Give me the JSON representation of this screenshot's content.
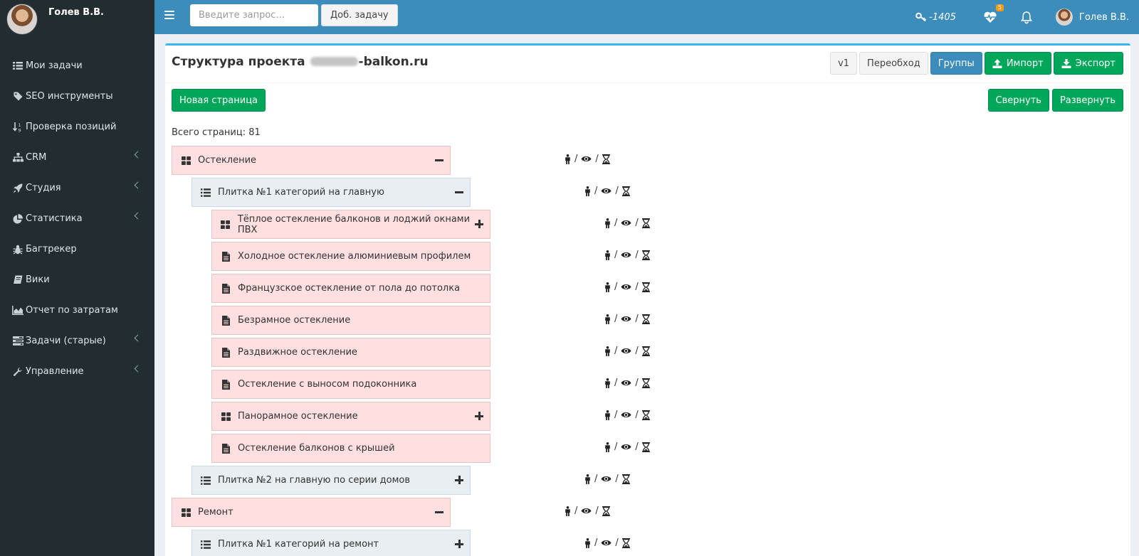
{
  "sidebar": {
    "user_name": "Голев В.В.",
    "items": [
      {
        "label": "Мои задачи",
        "icon": "list-icon",
        "has_children": false
      },
      {
        "label": "SEO инструменты",
        "icon": "tag-icon",
        "has_children": false
      },
      {
        "label": "Проверка позиций",
        "icon": "sort-numeric-icon",
        "has_children": false
      },
      {
        "label": "CRM",
        "icon": "sitemap-icon",
        "has_children": true
      },
      {
        "label": "Студия",
        "icon": "rocket-icon",
        "has_children": true
      },
      {
        "label": "Статистика",
        "icon": "pie-chart-icon",
        "has_children": true
      },
      {
        "label": "Багтрекер",
        "icon": "bug-icon",
        "has_children": false
      },
      {
        "label": "Вики",
        "icon": "book-icon",
        "has_children": false
      },
      {
        "label": "Отчет по затратам",
        "icon": "area-chart-icon",
        "has_children": false
      },
      {
        "label": "Задачи (старые)",
        "icon": "tasks-icon",
        "has_children": true
      },
      {
        "label": "Управление",
        "icon": "wrench-icon",
        "has_children": true
      }
    ]
  },
  "header": {
    "search_placeholder": "Введите запрос...",
    "add_task_label": "Доб. задачу",
    "key_count": "-1405",
    "health_badge": "5",
    "user_name": "Голев В.В."
  },
  "content": {
    "title_prefix": "Структура проекта",
    "title_suffix": "-balkon.ru",
    "tools": {
      "v1": "v1",
      "recrawl": "Переобход",
      "groups": "Группы",
      "import": "Импорт",
      "export": "Экспорт"
    },
    "new_page_label": "Новая страница",
    "collapse_label": "Свернуть",
    "expand_label": "Развернуть",
    "total_label": "Всего страниц: 81"
  },
  "tree": [
    {
      "label": "Остекление",
      "level": 0,
      "type": "group",
      "toggle": "minus"
    },
    {
      "label": "Плитка №1 категорий на главную",
      "level": 1,
      "type": "list",
      "toggle": "minus"
    },
    {
      "label": "Тёплое остекление балконов и лоджий окнами ПВХ",
      "level": 2,
      "type": "group",
      "toggle": "plus"
    },
    {
      "label": "Холодное остекление алюминиевым профилем",
      "level": 2,
      "type": "page",
      "toggle": "none"
    },
    {
      "label": "Французское остекление от пола до потолка",
      "level": 2,
      "type": "page",
      "toggle": "none"
    },
    {
      "label": "Безрамное остекление",
      "level": 2,
      "type": "page",
      "toggle": "none"
    },
    {
      "label": "Раздвижное остекление",
      "level": 2,
      "type": "page",
      "toggle": "none"
    },
    {
      "label": "Остекление с выносом подоконника",
      "level": 2,
      "type": "page",
      "toggle": "none"
    },
    {
      "label": "Панорамное остекление",
      "level": 2,
      "type": "group",
      "toggle": "plus"
    },
    {
      "label": "Остекление балконов с крышей",
      "level": 2,
      "type": "page",
      "toggle": "none"
    },
    {
      "label": "Плитка №2 на главную по серии домов",
      "level": 1,
      "type": "list",
      "toggle": "plus"
    },
    {
      "label": "Ремонт",
      "level": 0,
      "type": "group",
      "toggle": "minus"
    },
    {
      "label": "Плитка №1 категорий на ремонт",
      "level": 1,
      "type": "list",
      "toggle": "plus"
    }
  ],
  "meta_separator": "/"
}
